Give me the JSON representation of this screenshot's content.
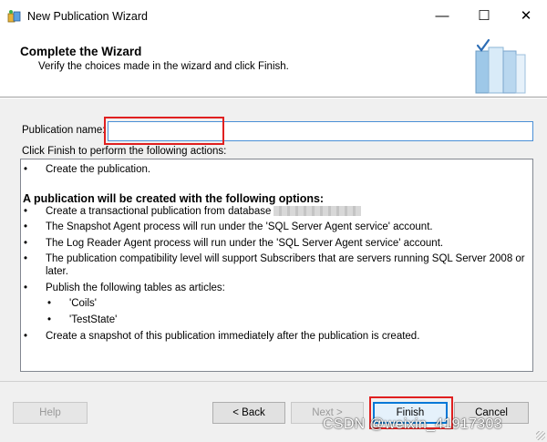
{
  "window": {
    "title": "New Publication Wizard",
    "minimize_glyph": "—",
    "maximize_glyph": "☐",
    "close_glyph": "✕",
    "app_icon": "wizard-app-icon"
  },
  "header": {
    "title": "Complete the Wizard",
    "subtitle": "Verify the choices made in the wizard and click Finish.",
    "art_icon": "books-checkmark-icon"
  },
  "form": {
    "publication_name_label": "Publication name:",
    "publication_name_value": "",
    "actions_label": "Click Finish to perform the following actions:"
  },
  "actions": {
    "bullet": "•",
    "create_publication": "Create the publication.",
    "options_heading": "A publication will be created with the following options:",
    "create_transactional": "Create a transactional publication from database",
    "snapshot_agent": "The Snapshot Agent process will run under the 'SQL Server Agent service' account.",
    "log_reader_agent": "The Log Reader Agent process will run under the 'SQL Server Agent service' account.",
    "compat_line1": "The publication compatibility level will support Subscribers that are servers running SQL Server 2008 or",
    "compat_line2": "later.",
    "publish_tables": "Publish the following tables as articles:",
    "table1": "'Coils'",
    "table2": "'TestState'",
    "create_snapshot": "Create a snapshot of this publication immediately after the publication is created."
  },
  "buttons": {
    "help": "Help",
    "back": "< Back",
    "next": "Next >",
    "finish": "Finish",
    "cancel": "Cancel"
  },
  "watermark": "CSDN @weixin_41917303",
  "colors": {
    "highlight_red": "#e02020",
    "focus_blue": "#0078d7",
    "dialog_bg": "#f0f0f0"
  }
}
